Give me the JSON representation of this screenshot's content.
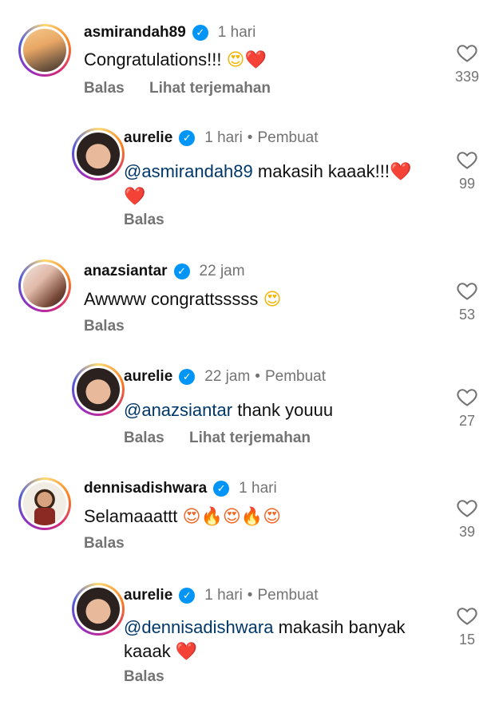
{
  "comments": [
    {
      "username": "asmirandah89",
      "time": "1 hari",
      "creator": "",
      "mention": "",
      "text": "Congratulations!!! ",
      "emojis": "😍❤️",
      "likes": "339",
      "actions": [
        "Balas",
        "Lihat terjemahan"
      ]
    },
    {
      "username": "aurelie",
      "time": "1 hari",
      "creator": "Pembuat",
      "mention": "@asmirandah89",
      "text": " makasih kaaak!!!",
      "emojis": "❤️",
      "emojis2": "❤️",
      "likes": "99",
      "actions": [
        "Balas"
      ]
    },
    {
      "username": "anazsiantar",
      "time": "22 jam",
      "creator": "",
      "mention": "",
      "text": "Awwww congrattsssss ",
      "emojis": "😍",
      "likes": "53",
      "actions": [
        "Balas"
      ]
    },
    {
      "username": "aurelie",
      "time": "22 jam",
      "creator": "Pembuat",
      "mention": "@anazsiantar",
      "text": " thank youuu",
      "emojis": "",
      "likes": "27",
      "actions": [
        "Balas",
        "Lihat terjemahan"
      ]
    },
    {
      "username": "dennisadishwara",
      "time": "1 hari",
      "creator": "",
      "mention": "",
      "text": "Selamaaattt ",
      "emojis": "😍🔥😍🔥😍",
      "likes": "39",
      "actions": [
        "Balas"
      ]
    },
    {
      "username": "aurelie",
      "time": "1 hari",
      "creator": "Pembuat",
      "mention": "@dennisadishwara",
      "text": " makasih banyak",
      "text2": "kaaak ",
      "emojis": "❤️",
      "likes": "15",
      "actions": [
        "Balas"
      ]
    }
  ],
  "icons": {
    "verified": "verified-badge-icon",
    "like": "heart-outline-icon"
  },
  "colors": {
    "mention": "#00376b",
    "verified": "#0095f6",
    "meta": "#737373"
  }
}
